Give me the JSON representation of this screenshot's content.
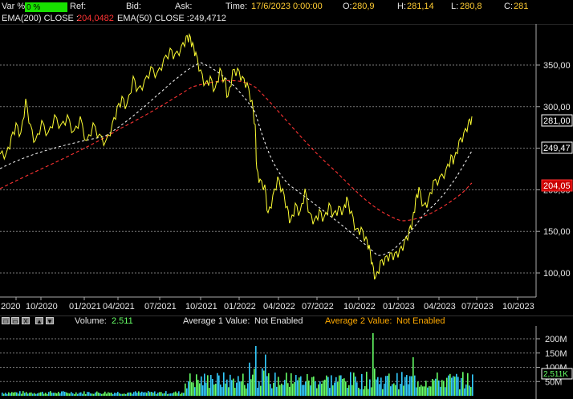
{
  "header": {
    "var_label": "Var %:",
    "var_value": "0 %",
    "ref_label": "Ref:",
    "bid_label": "Bid:",
    "ask_label": "Ask:",
    "time_label": "Time:",
    "time_value": "17/6/2023 0:00:00",
    "open_label": "O:",
    "open_value": "280,9",
    "high_label": "H:",
    "high_value": "281,14",
    "low_label": "L:",
    "low_value": "280,8",
    "close_label": "C:",
    "close_value": "281"
  },
  "ema": {
    "ema200_label": "EMA(200) CLOSE :",
    "ema200_value": "204,0482",
    "ema50_label": "EMA(50) CLOSE :",
    "ema50_value": "249,4712"
  },
  "price_axis": {
    "ticks": [
      "350,00",
      "300,00",
      "250,00",
      "200,00",
      "150,00",
      "100,00"
    ],
    "tick_values": [
      350,
      300,
      250,
      200,
      150,
      100
    ],
    "last_price_label": "281,00",
    "ema50_label": "249,47",
    "ema200_label": "204,05"
  },
  "time_axis": {
    "ticks": [
      "2020",
      "10/2020",
      "01/2021",
      "04/2021",
      "07/2021",
      "10/2021",
      "01/2022",
      "04/2022",
      "07/2022",
      "10/2022",
      "01/2023",
      "04/2023",
      "07/2023",
      "10/2023"
    ]
  },
  "volume_bar": {
    "buttons": [
      "□",
      "▭",
      "X",
      "▲",
      "▼"
    ],
    "volume_label": "Volume:",
    "volume_value": "2.511",
    "avg1_label": "Average 1 Value:",
    "avg1_value": "Not Enabled",
    "avg2_label": "Average 2 Value:",
    "avg2_value": "Not Enabled"
  },
  "volume_axis": {
    "ticks": [
      "200M",
      "150M",
      "100M",
      "50M"
    ],
    "tick_values": [
      200,
      150,
      100,
      50
    ],
    "last_label": "2,511K"
  },
  "colors": {
    "price": "#ffff33",
    "ema50": "#ffffff",
    "ema200": "#ff3333",
    "volume_a": "#33ccff",
    "volume_b": "#66ff66",
    "grid": "#888888",
    "accent_green": "#18e000"
  }
}
